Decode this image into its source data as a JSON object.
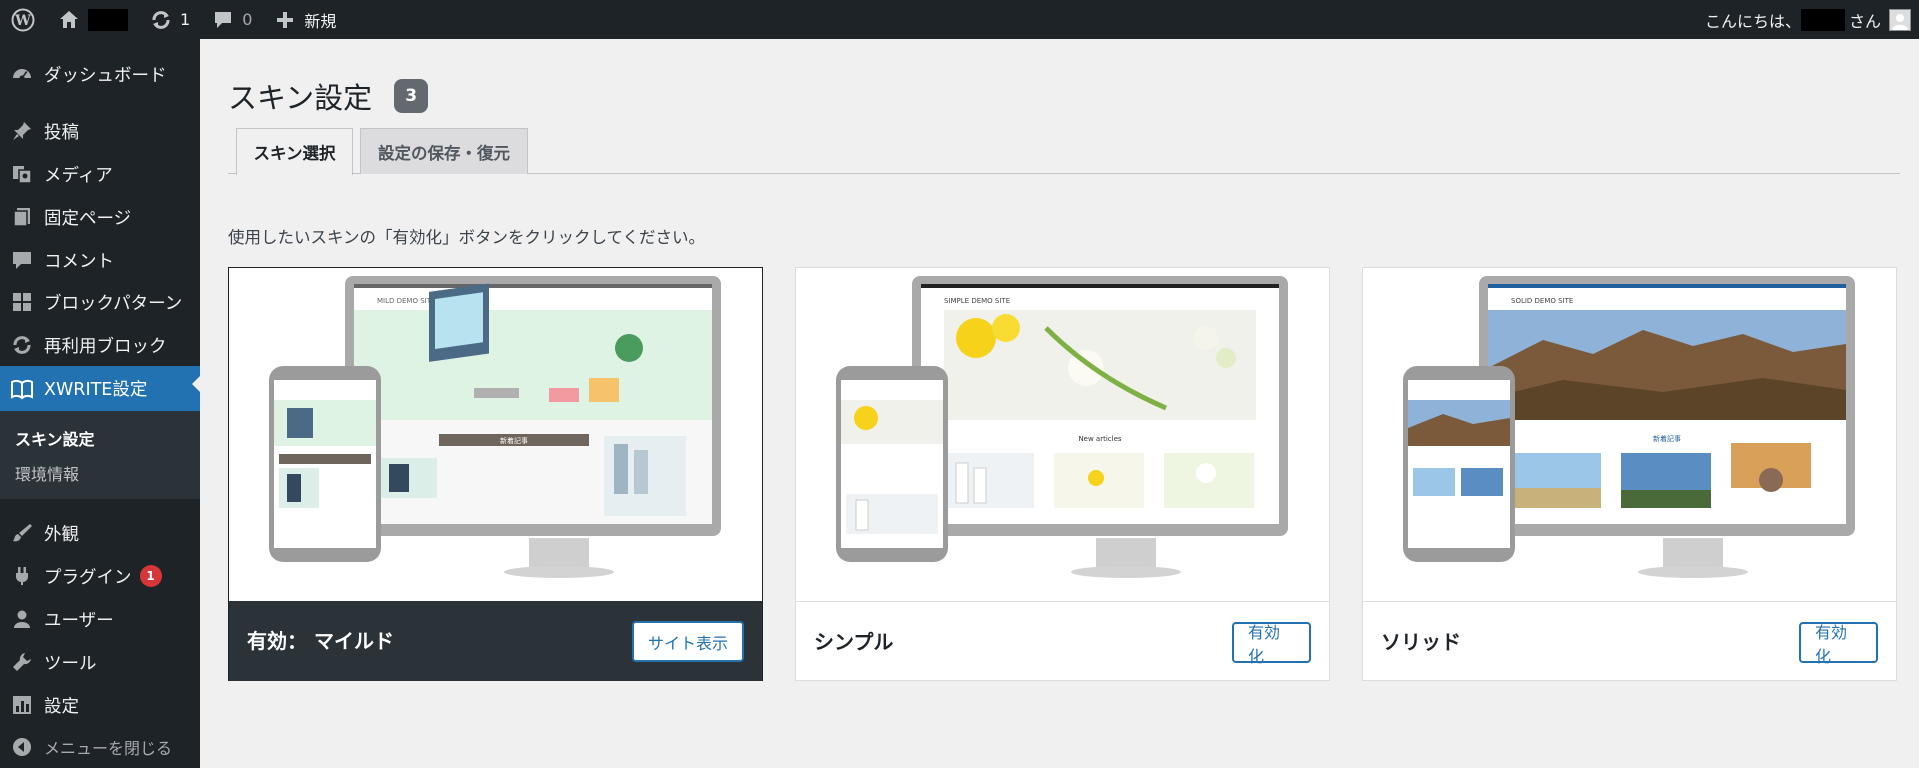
{
  "admin_bar": {
    "updates_count": "1",
    "comments_count": "0",
    "new_label": "新規",
    "greeting_prefix": "こんにちは、",
    "greeting_suffix": "さん"
  },
  "sidebar": {
    "items": [
      {
        "label": "ダッシュボード",
        "icon": "dashboard-icon"
      },
      {
        "label": "投稿",
        "icon": "pin-icon"
      },
      {
        "label": "メディア",
        "icon": "media-icon"
      },
      {
        "label": "固定ページ",
        "icon": "page-icon"
      },
      {
        "label": "コメント",
        "icon": "comment-icon"
      },
      {
        "label": "ブロックパターン",
        "icon": "grid-icon"
      },
      {
        "label": "再利用ブロック",
        "icon": "refresh-icon"
      },
      {
        "label": "XWRITE設定",
        "icon": "book-icon"
      },
      {
        "label": "外観",
        "icon": "brush-icon"
      },
      {
        "label": "プラグイン",
        "icon": "plugin-icon",
        "badge": "1"
      },
      {
        "label": "ユーザー",
        "icon": "user-icon"
      },
      {
        "label": "ツール",
        "icon": "wrench-icon"
      },
      {
        "label": "設定",
        "icon": "settings-icon"
      }
    ],
    "submenu": [
      {
        "label": "スキン設定"
      },
      {
        "label": "環境情報"
      }
    ],
    "collapse_label": "メニューを閉じる"
  },
  "main": {
    "title": "スキン設定",
    "title_badge": "3",
    "tabs": [
      {
        "label": "スキン選択"
      },
      {
        "label": "設定の保存・復元"
      }
    ],
    "instruction": "使用したいスキンの「有効化」ボタンをクリックしてください。",
    "skins": [
      {
        "name": "有効： マイルド",
        "button": "サイト表示",
        "demo_title": "MILD DEMO SITE",
        "section_label": "新着記事"
      },
      {
        "name": "シンプル",
        "button": "有効化",
        "demo_title": "SIMPLE DEMO SITE",
        "section_label": "New articles"
      },
      {
        "name": "ソリッド",
        "button": "有効化",
        "demo_title": "SOLID DEMO SITE",
        "section_label": "新着記事"
      }
    ]
  },
  "colors": {
    "admin_dark": "#1d2327",
    "accent_blue": "#2271b1",
    "badge_red": "#d63638"
  }
}
